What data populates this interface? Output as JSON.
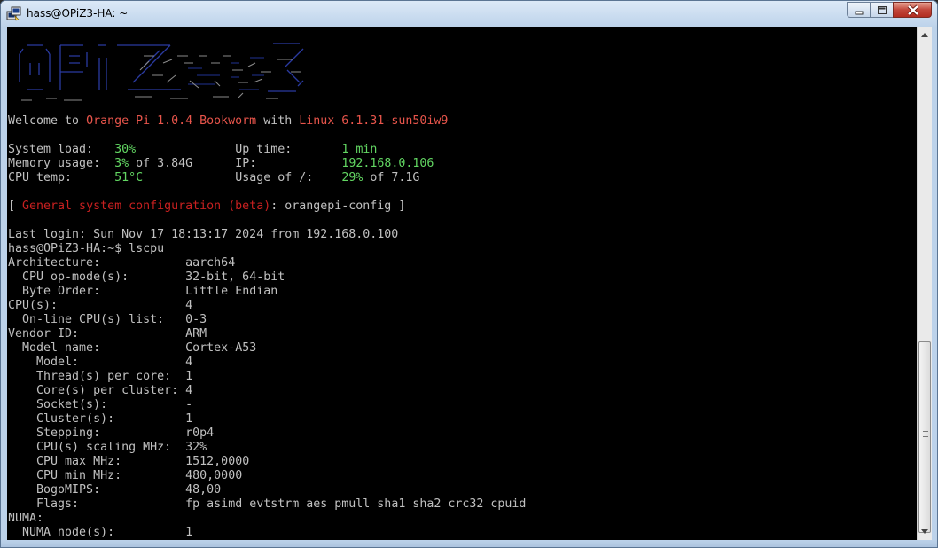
{
  "window": {
    "title": "hass@OPiZ3-HA: ~"
  },
  "terminal": {
    "welcome": {
      "prefix": "Welcome to ",
      "os": "Orange Pi 1.0.4 Bookworm",
      "mid": " with ",
      "kernel": "Linux 6.1.31-sun50iw9"
    },
    "stats": [
      {
        "label": "System load:",
        "value": "30%",
        "label2": "Up time:",
        "value2": "1 min"
      },
      {
        "label": "Memory usage:",
        "value": "3%",
        "suffix": " of 3.84G",
        "label2": "IP:",
        "value2": "192.168.0.106"
      },
      {
        "label": "CPU temp:",
        "value": "51°C",
        "label2": "Usage of /:",
        "value2": "29%",
        "suffix2": " of 7.1G"
      }
    ],
    "config": {
      "open": "[ ",
      "label": "General system configuration (beta)",
      "mid": ": orangepi-config ]"
    },
    "last_login": "Last login: Sun Nov 17 18:13:17 2024 from 192.168.0.100",
    "prompt": "hass@OPiZ3-HA:~$ lscpu",
    "lscpu": [
      {
        "k": "Architecture:",
        "v": "aarch64"
      },
      {
        "k": "  CPU op-mode(s):",
        "v": "32-bit, 64-bit"
      },
      {
        "k": "  Byte Order:",
        "v": "Little Endian"
      },
      {
        "k": "CPU(s):",
        "v": "4"
      },
      {
        "k": "  On-line CPU(s) list:",
        "v": "0-3"
      },
      {
        "k": "Vendor ID:",
        "v": "ARM"
      },
      {
        "k": "  Model name:",
        "v": "Cortex-A53"
      },
      {
        "k": "    Model:",
        "v": "4"
      },
      {
        "k": "    Thread(s) per core:",
        "v": "1"
      },
      {
        "k": "    Core(s) per cluster:",
        "v": "4"
      },
      {
        "k": "    Socket(s):",
        "v": "-"
      },
      {
        "k": "    Cluster(s):",
        "v": "1"
      },
      {
        "k": "    Stepping:",
        "v": "r0p4"
      },
      {
        "k": "    CPU(s) scaling MHz:",
        "v": "32%"
      },
      {
        "k": "    CPU max MHz:",
        "v": "1512,0000"
      },
      {
        "k": "    CPU min MHz:",
        "v": "480,0000"
      },
      {
        "k": "    BogoMIPS:",
        "v": "48,00"
      },
      {
        "k": "    Flags:",
        "v": "fp asimd evtstrm aes pmull sha1 sha2 crc32 cpuid"
      },
      {
        "k": "NUMA:",
        "v": ""
      },
      {
        "k": "  NUMA node(s):",
        "v": "1"
      }
    ]
  },
  "colors": {
    "logo_blue": "#2a3aa0",
    "welcome_red": "#e8554b",
    "config_red": "#c82020",
    "value_green": "#62d662"
  },
  "icons": [
    "putty-icon",
    "minimize-icon",
    "maximize-icon",
    "close-icon",
    "scroll-up-icon",
    "scroll-down-icon"
  ]
}
